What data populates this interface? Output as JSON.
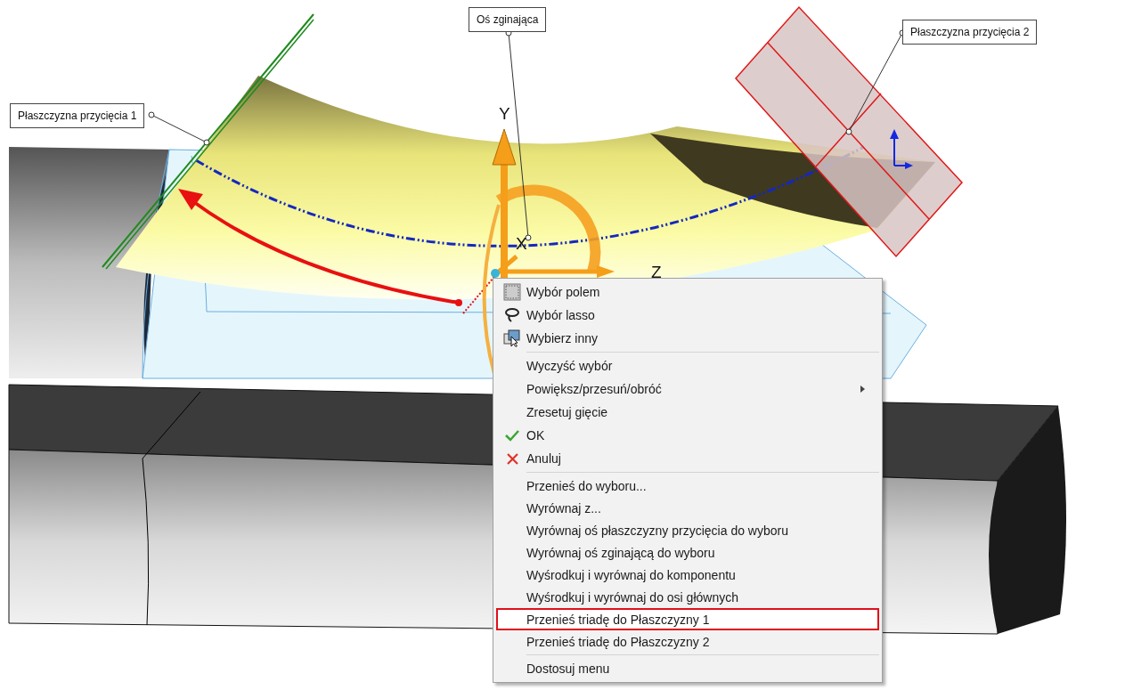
{
  "callouts": [
    {
      "label": "Płaszczyzna przycięcia 1"
    },
    {
      "label": "Oś zginająca"
    },
    {
      "label": "Płaszczyzna przycięcia 2"
    }
  ],
  "axes": [
    {
      "label": "Y"
    },
    {
      "label": "X"
    },
    {
      "label": "Z"
    }
  ],
  "context_menu": {
    "groups": [
      {
        "items": [
          {
            "label": "Wybór polem",
            "kind": "box-select",
            "selected": false
          },
          {
            "label": "Wybór lasso",
            "kind": "lasso",
            "selected": false
          },
          {
            "label": "Wybierz inny",
            "kind": "select-other",
            "selected": false
          }
        ]
      },
      {
        "items": [
          {
            "label": "Wyczyść wybór",
            "kind": "plain",
            "selected": false
          },
          {
            "label": "Powiększ/przesuń/obróć",
            "kind": "submenu",
            "selected": false
          },
          {
            "label": "Zresetuj gięcie",
            "kind": "plain",
            "selected": false
          },
          {
            "label": "OK",
            "kind": "ok",
            "selected": false
          },
          {
            "label": "Anuluj",
            "kind": "cancel",
            "selected": false
          }
        ]
      },
      {
        "items": [
          {
            "label": "Przenieś do wyboru...",
            "kind": "plain",
            "selected": false
          },
          {
            "label": "Wyrównaj z...",
            "kind": "plain",
            "selected": false
          },
          {
            "label": "Wyrównaj oś płaszczyzny przycięcia do wyboru",
            "kind": "plain",
            "selected": false
          },
          {
            "label": "Wyrównaj oś zginającą do wyboru",
            "kind": "plain",
            "selected": false
          },
          {
            "label": "Wyśrodkuj i wyrównaj do komponentu",
            "kind": "plain",
            "selected": false
          },
          {
            "label": "Wyśrodkuj i wyrównaj do osi głównych",
            "kind": "plain",
            "selected": false
          },
          {
            "label": "Przenieś triadę do Płaszczyzny 1",
            "kind": "plain",
            "selected": true
          },
          {
            "label": "Przenieś triadę do Płaszczyzny 2",
            "kind": "plain",
            "selected": false
          }
        ]
      },
      {
        "items": [
          {
            "label": "Dostosuj menu",
            "kind": "plain",
            "selected": false
          }
        ]
      }
    ]
  }
}
